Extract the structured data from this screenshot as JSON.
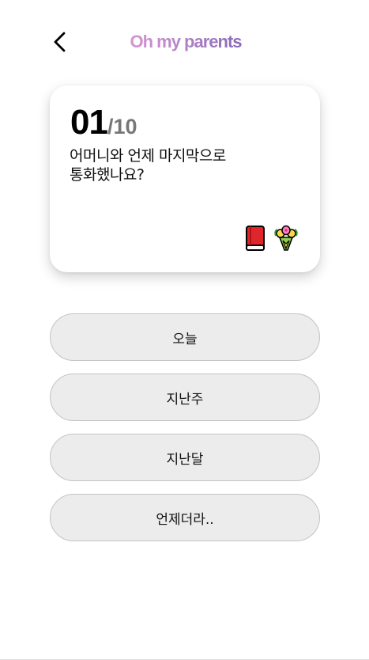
{
  "header": {
    "back_icon": "chevron-left-icon",
    "title": "Oh my parents",
    "title_gradient": [
      "#e39ad3",
      "#b685c9",
      "#7b5fb2"
    ]
  },
  "card": {
    "current": "01",
    "separator": "/",
    "total": "10",
    "progress_fraction": 0.1,
    "question": "어머니와 언제 마지막으로\n통화했나요?",
    "icons": [
      "red-book-icon",
      "flower-bouquet-icon"
    ]
  },
  "answers": [
    {
      "label": "오늘"
    },
    {
      "label": "지난주"
    },
    {
      "label": "지난달"
    },
    {
      "label": "언제더라.."
    }
  ],
  "colors": {
    "answer_bg": "#ececec",
    "answer_border": "#c4c4c4",
    "counter_total": "#777777"
  }
}
